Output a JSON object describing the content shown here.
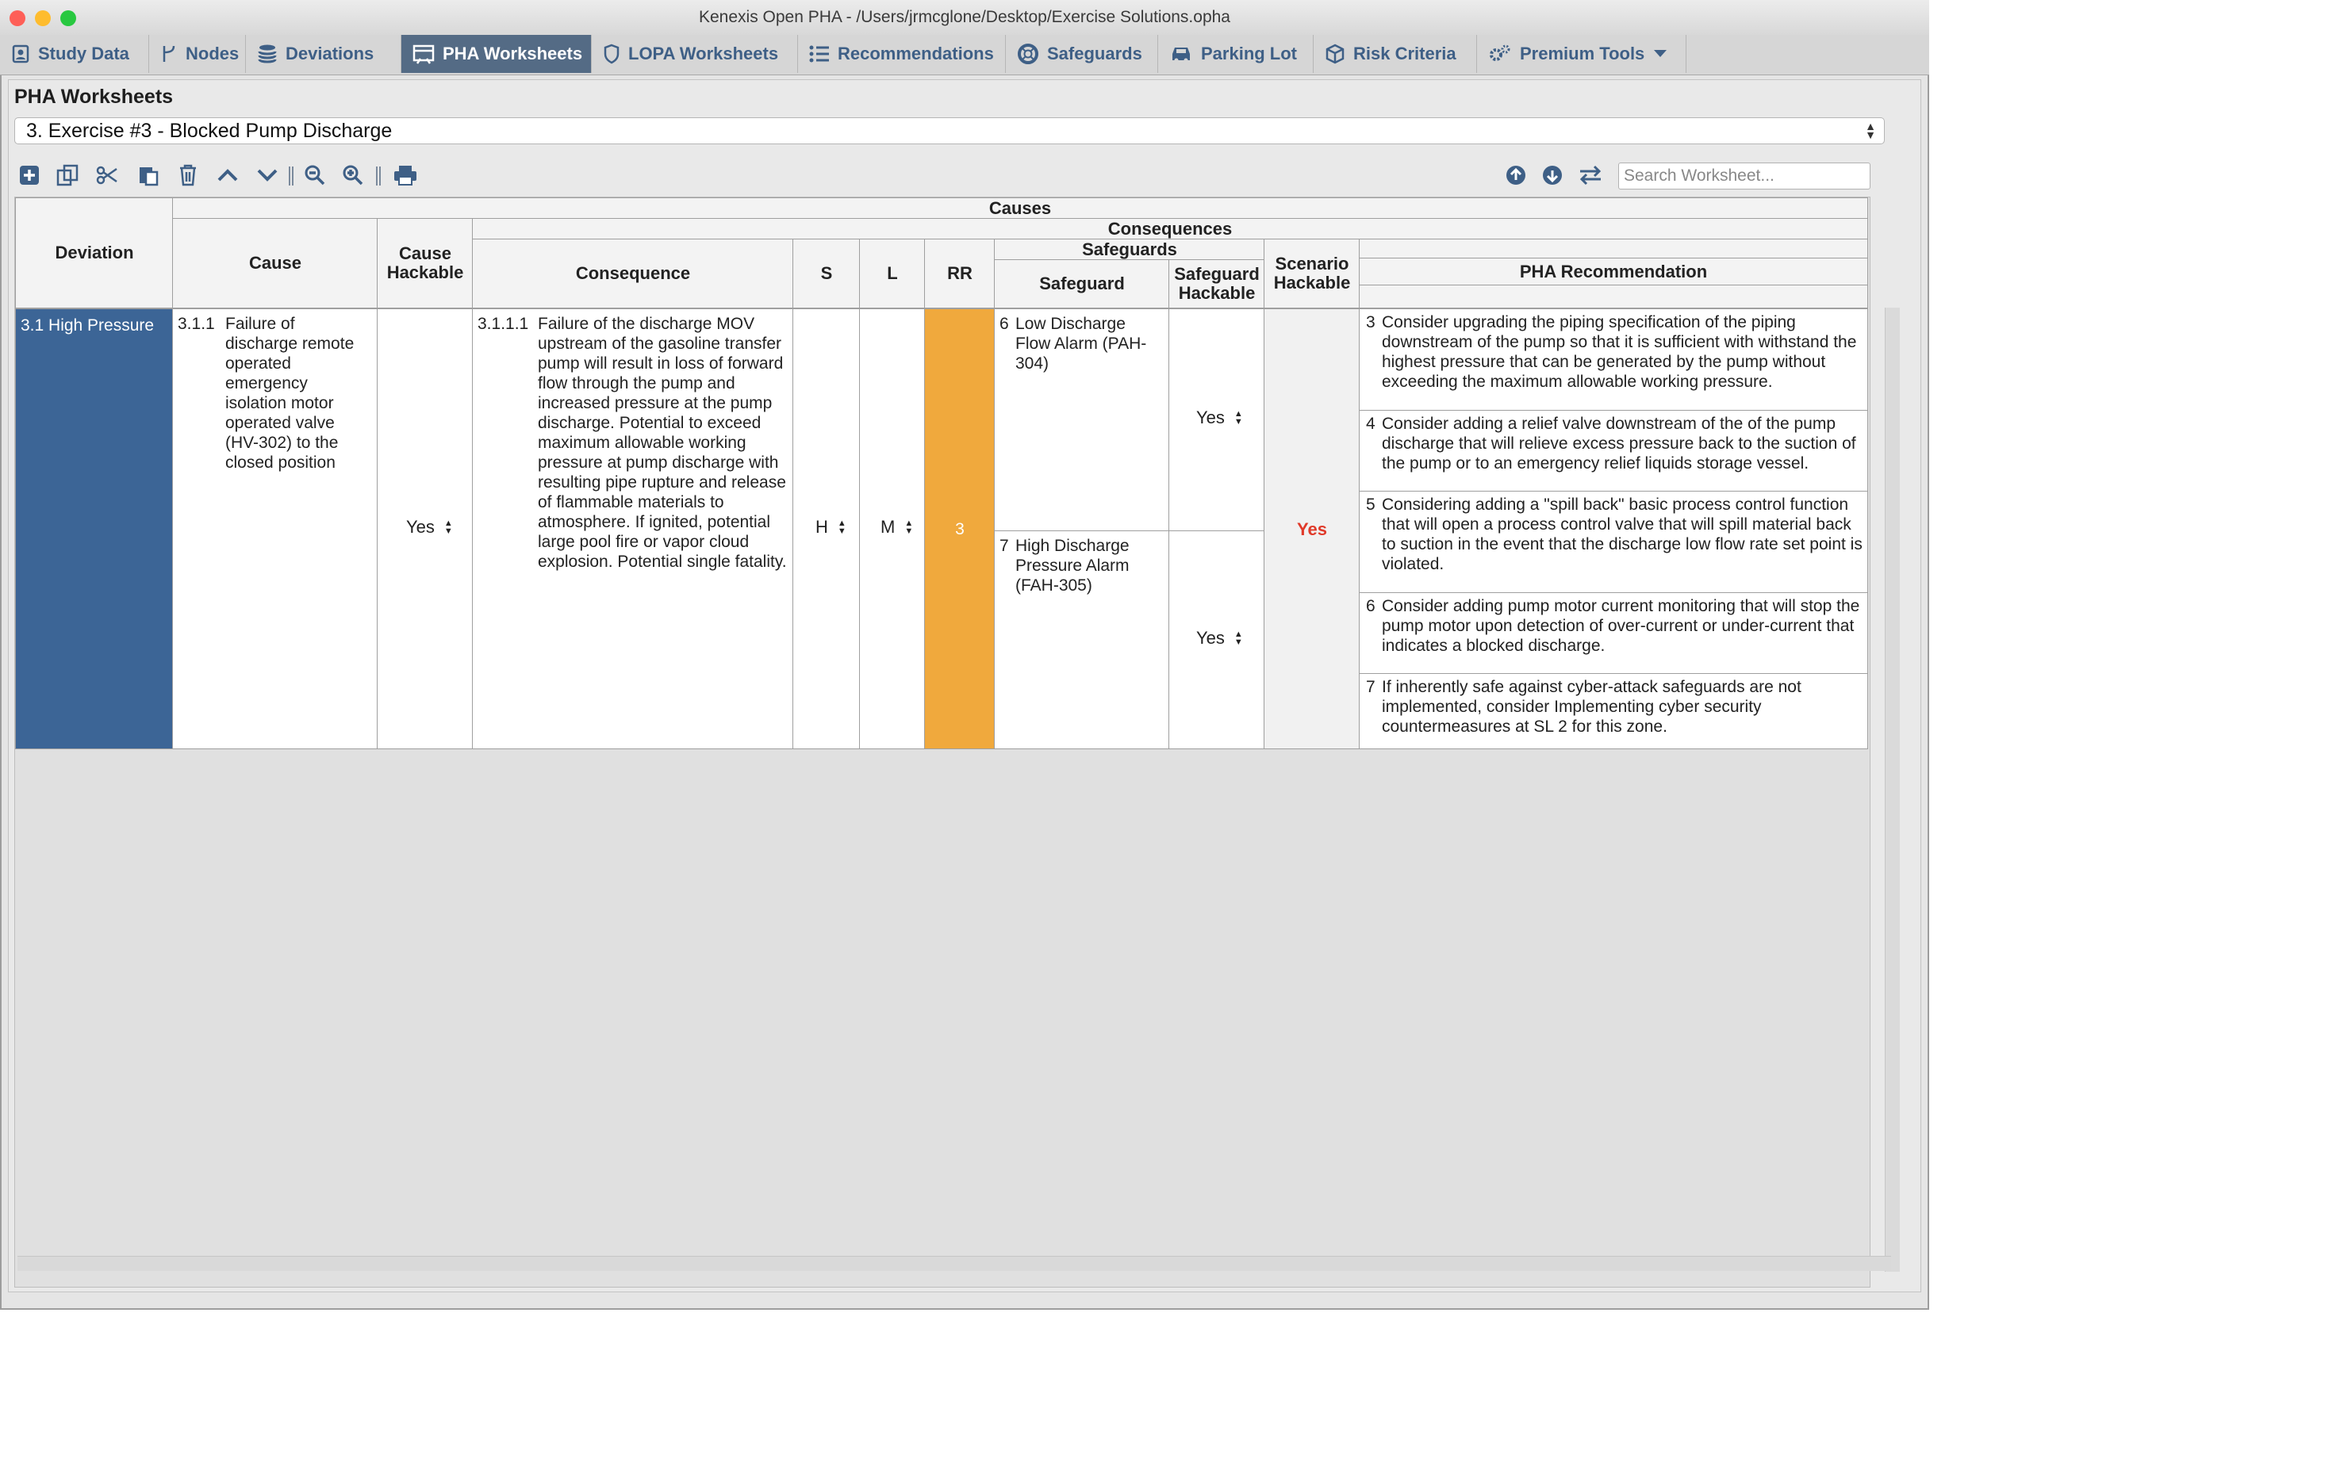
{
  "window": {
    "title": "Kenexis Open PHA - /Users/jrmcglone/Desktop/Exercise Solutions.opha"
  },
  "tabs": [
    {
      "label": "Study Data",
      "icon": "study-data-icon"
    },
    {
      "label": "Nodes",
      "icon": "nodes-icon"
    },
    {
      "label": "Deviations",
      "icon": "deviations-icon"
    },
    {
      "label": "PHA Worksheets",
      "icon": "worksheet-icon",
      "active": true
    },
    {
      "label": "LOPA Worksheets",
      "icon": "shield-icon"
    },
    {
      "label": "Recommendations",
      "icon": "list-icon"
    },
    {
      "label": "Safeguards",
      "icon": "lifebuoy-icon"
    },
    {
      "label": "Parking Lot",
      "icon": "car-icon"
    },
    {
      "label": "Risk Criteria",
      "icon": "cube-icon"
    },
    {
      "label": "Premium Tools",
      "icon": "gears-icon"
    }
  ],
  "section": {
    "title": "PHA Worksheets",
    "selected_worksheet": "3. Exercise #3 - Blocked Pump Discharge"
  },
  "toolbar": {
    "left_icons": [
      "add-icon",
      "copy-icon",
      "cut-icon",
      "paste-icon",
      "delete-icon",
      "move-up-icon",
      "move-down-icon",
      "zoom-out-icon",
      "zoom-in-icon",
      "print-icon"
    ],
    "right_icons": [
      "scroll-up-icon",
      "scroll-down-icon",
      "swap-icon"
    ],
    "search_placeholder": "Search Worksheet..."
  },
  "headers": {
    "causes": "Causes",
    "consequences": "Consequences",
    "safeguards": "Safeguards",
    "deviation": "Deviation",
    "cause": "Cause",
    "cause_hackable": "Cause Hackable",
    "consequence": "Consequence",
    "s": "S",
    "l": "L",
    "rr": "RR",
    "safeguard": "Safeguard",
    "safeguard_hackable": "Safeguard Hackable",
    "scenario_hackable": "Scenario Hackable",
    "pha_recommendation": "PHA Recommendation"
  },
  "row": {
    "deviation": "3.1 High Pressure",
    "cause_num": "3.1.1",
    "cause": "Failure of discharge remote operated emergency isolation motor operated valve (HV-302) to the closed position",
    "cause_hackable": "Yes",
    "consequence_num": "3.1.1.1",
    "consequence": "Failure of the discharge MOV upstream of the gasoline transfer pump will result in loss of forward flow through the pump and increased pressure at the pump discharge.  Potential to exceed maximum allowable working pressure at pump discharge with resulting pipe rupture and release of flammable materials to atmosphere.  If ignited, potential large pool fire or vapor cloud explosion.  Potential single fatality.",
    "severity": "H",
    "likelihood": "M",
    "risk_ranking": "3",
    "risk_color": "#f0a93d",
    "scenario_hackable": "Yes",
    "safeguards": [
      {
        "num": "6",
        "text": "Low Discharge Flow Alarm (PAH-304)",
        "hackable": "Yes"
      },
      {
        "num": "7",
        "text": "High Discharge Pressure Alarm (FAH-305)",
        "hackable": "Yes"
      }
    ],
    "recommendations": [
      {
        "num": "3",
        "text": "Consider upgrading the piping specification of the piping downstream of the pump so that it is sufficient with withstand the highest pressure that can be generated by the pump without exceeding the maximum allowable working pressure."
      },
      {
        "num": "4",
        "text": "Consider adding a relief valve downstream of the of the pump discharge that will relieve excess pressure back to the suction of the pump or to an emergency relief liquids storage vessel."
      },
      {
        "num": "5",
        "text": "Considering adding a \"spill back\" basic process control function that will open a process control valve that will spill material back to suction in the event that the discharge low flow rate set point is violated."
      },
      {
        "num": "6",
        "text": "Consider adding pump motor current monitoring that will stop the pump motor upon detection of over-current or under-current that indicates a blocked discharge."
      },
      {
        "num": "7",
        "text": "If inherently safe against cyber-attack safeguards are not implemented, consider Implementing cyber security countermeasures at SL 2 for this zone."
      }
    ]
  }
}
